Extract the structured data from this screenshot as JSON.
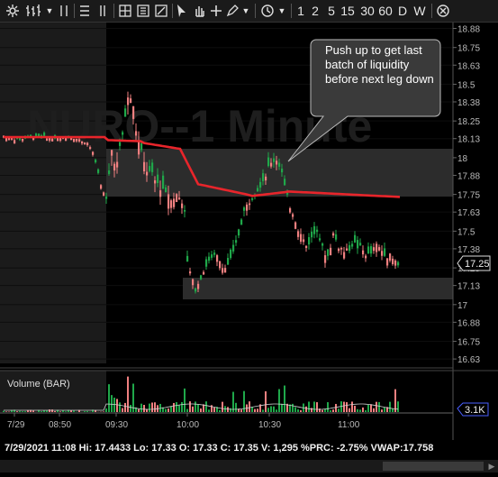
{
  "toolbar": {
    "interval_buttons": [
      "1",
      "2",
      "5",
      "15",
      "30",
      "60",
      "D",
      "W"
    ],
    "icons": [
      "settings-icon",
      "bar-style-icon",
      "dropdown-arrow-icon",
      "layout-icon",
      "link-icon",
      "grid-icon",
      "template-icon",
      "crop-icon",
      "cursor-icon",
      "pan-icon",
      "crosshair-icon",
      "pencil-icon",
      "dropdown-arrow-icon",
      "clock-icon",
      "dropdown-arrow-icon",
      "close-circle-icon"
    ]
  },
  "chart": {
    "watermark": "NURO--1 Minute",
    "price_axis": [
      "18.88",
      "18.75",
      "18.63",
      "18.5",
      "18.38",
      "18.25",
      "18.13",
      "18",
      "17.88",
      "17.75",
      "17.63",
      "17.5",
      "17.38",
      "17.25",
      "17.13",
      "17",
      "16.88",
      "16.75",
      "16.63"
    ],
    "current_price": "17.25",
    "callout": "Push up to get last batch of liquidity before next leg down",
    "volume_label": "Volume (BAR)",
    "volume_value": "3.1K",
    "time_axis": [
      "7/29",
      "08:50",
      "09:30",
      "10:00",
      "10:30",
      "11:00"
    ],
    "colors": {
      "up": "#1fa84a",
      "down": "#f08080",
      "vwap": "#e8252b",
      "zone": "#2c2c2c",
      "premarket": "#1b1b1b"
    }
  },
  "status": {
    "text": "7/29/2021 11:08  Hi: 17.4433  Lo: 17.33  O: 17.33  C: 17.35  V: 1,295 %PRC: -2.75% VWAP:17.758"
  },
  "chart_data": {
    "type": "candlestick",
    "title": "NURO--1 Minute",
    "ylim": [
      16.6,
      18.92
    ],
    "xlabel": "",
    "ylabel": "",
    "x_ticks": [
      "7/29",
      "08:50",
      "09:30",
      "10:00",
      "10:30",
      "11:00"
    ],
    "current_price": 17.25,
    "vwap": 17.758,
    "session": {
      "date": "7/29/2021",
      "time": "11:08",
      "high": 17.4433,
      "low": 17.33,
      "open": 17.33,
      "close": 17.35,
      "volume": 1295,
      "pct_change": -2.75
    }
  }
}
